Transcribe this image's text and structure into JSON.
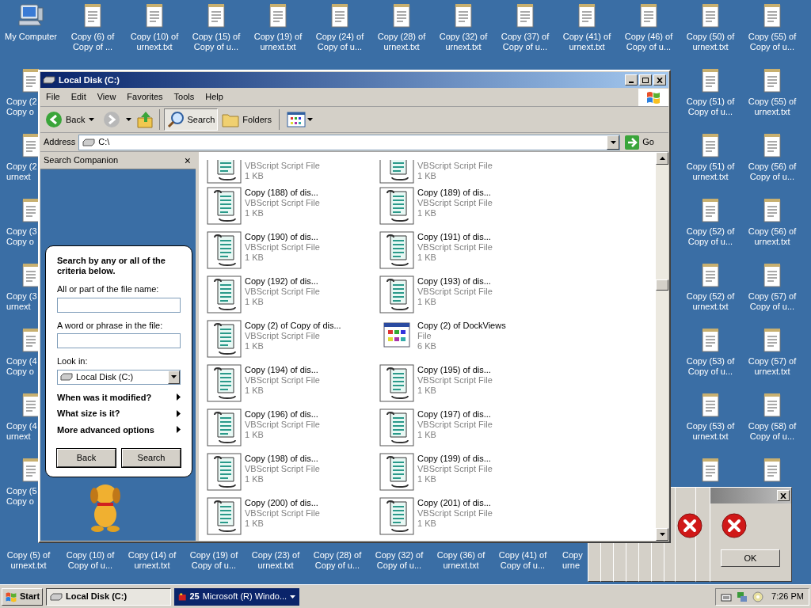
{
  "desktop": {
    "top_row": [
      {
        "kind": "computer",
        "lines": [
          "My Computer"
        ]
      },
      {
        "kind": "text",
        "lines": [
          "Copy (6) of",
          "Copy of ..."
        ]
      },
      {
        "kind": "text",
        "lines": [
          "Copy (10) of",
          "urnext.txt"
        ]
      },
      {
        "kind": "text",
        "lines": [
          "Copy (15) of",
          "Copy of u..."
        ]
      },
      {
        "kind": "text",
        "lines": [
          "Copy (19) of",
          "urnext.txt"
        ]
      },
      {
        "kind": "text",
        "lines": [
          "Copy (24) of",
          "Copy of u..."
        ]
      },
      {
        "kind": "text",
        "lines": [
          "Copy (28) of",
          "urnext.txt"
        ]
      },
      {
        "kind": "text",
        "lines": [
          "Copy (32) of",
          "urnext.txt"
        ]
      },
      {
        "kind": "text",
        "lines": [
          "Copy (37) of",
          "Copy of u..."
        ]
      },
      {
        "kind": "text",
        "lines": [
          "Copy (41) of",
          "urnext.txt"
        ]
      },
      {
        "kind": "text",
        "lines": [
          "Copy (46) of",
          "Copy of u..."
        ]
      },
      {
        "kind": "text",
        "lines": [
          "Copy (50) of",
          "urnext.txt"
        ]
      },
      {
        "kind": "text",
        "lines": [
          "Copy (55) of",
          "Copy of u..."
        ]
      }
    ],
    "left_column": [
      {
        "kind": "text",
        "lines": [
          "Copy (2",
          "Copy o"
        ]
      },
      {
        "kind": "text",
        "lines": [
          "Copy (2",
          "urnext"
        ]
      },
      {
        "kind": "text",
        "lines": [
          "Copy (3",
          "Copy o"
        ]
      },
      {
        "kind": "text",
        "lines": [
          "Copy (3",
          "urnext"
        ]
      },
      {
        "kind": "text",
        "lines": [
          "Copy (4",
          "Copy o"
        ]
      },
      {
        "kind": "text",
        "lines": [
          "Copy (4",
          "urnext"
        ]
      },
      {
        "kind": "text",
        "lines": [
          "Copy (5",
          "Copy o"
        ]
      }
    ],
    "right_column_1": [
      {
        "kind": "text",
        "lines": [
          "Copy (51) of",
          "Copy of u..."
        ]
      },
      {
        "kind": "text",
        "lines": [
          "Copy (51) of",
          "urnext.txt"
        ]
      },
      {
        "kind": "text",
        "lines": [
          "Copy (52) of",
          "Copy of u..."
        ]
      },
      {
        "kind": "text",
        "lines": [
          "Copy (52) of",
          "urnext.txt"
        ]
      },
      {
        "kind": "text",
        "lines": [
          "Copy (53) of",
          "Copy of u..."
        ]
      },
      {
        "kind": "text",
        "lines": [
          "Copy (53) of",
          "urnext.txt"
        ]
      },
      {
        "kind": "text"
      }
    ],
    "right_column_2": [
      {
        "kind": "text",
        "lines": [
          "Copy (55) of",
          "urnext.txt"
        ]
      },
      {
        "kind": "text",
        "lines": [
          "Copy (56) of",
          "Copy of u..."
        ]
      },
      {
        "kind": "text",
        "lines": [
          "Copy (56) of",
          "urnext.txt"
        ]
      },
      {
        "kind": "text",
        "lines": [
          "Copy (57) of",
          "Copy of u..."
        ]
      },
      {
        "kind": "text",
        "lines": [
          "Copy (57) of",
          "urnext.txt"
        ]
      },
      {
        "kind": "text",
        "lines": [
          "Copy (58) of",
          "Copy of u..."
        ]
      },
      {
        "kind": "text"
      }
    ],
    "bottom_row": [
      {
        "lines": [
          "Copy (5) of",
          "urnext.txt"
        ]
      },
      {
        "lines": [
          "Copy (10) of",
          "Copy of u..."
        ]
      },
      {
        "lines": [
          "Copy (14) of",
          "urnext.txt"
        ]
      },
      {
        "lines": [
          "Copy (19) of",
          "Copy of u..."
        ]
      },
      {
        "lines": [
          "Copy (23) of",
          "urnext.txt"
        ]
      },
      {
        "lines": [
          "Copy (28) of",
          "Copy of u..."
        ]
      },
      {
        "lines": [
          "Copy (32) of",
          "Copy of u..."
        ]
      },
      {
        "lines": [
          "Copy (36) of",
          "urnext.txt"
        ]
      },
      {
        "lines": [
          "Copy (41) of",
          "Copy of u..."
        ]
      },
      {
        "lines": [
          "Copy",
          "urne"
        ]
      }
    ]
  },
  "window": {
    "title": "Local Disk (C:)",
    "menu": [
      "File",
      "Edit",
      "View",
      "Favorites",
      "Tools",
      "Help"
    ],
    "toolbar": {
      "back": "Back",
      "search": "Search",
      "folders": "Folders",
      "search_selected": true
    },
    "address": {
      "label": "Address",
      "value": "C:\\",
      "go": "Go"
    },
    "search_companion": {
      "title": "Search Companion",
      "close": "×",
      "heading": "Search by any or all of the criteria below.",
      "name_label": "All or part of the file name:",
      "phrase_label": "A word or phrase in the file:",
      "look_in_label": "Look in:",
      "look_in_value": "Local Disk (C:)",
      "options": [
        "When was it modified?",
        "What size is it?",
        "More advanced options"
      ],
      "buttons": [
        "Back",
        "Search"
      ]
    },
    "files": [
      [
        {
          "kind": "script",
          "type": "VBScript Script File",
          "size": "1 KB"
        },
        {
          "kind": "script",
          "type": "VBScript Script File",
          "size": "1 KB"
        }
      ],
      [
        {
          "kind": "script",
          "name": "Copy (188) of dis...",
          "type": "VBScript Script File",
          "size": "1 KB"
        },
        {
          "kind": "script",
          "name": "Copy (189) of dis...",
          "type": "VBScript Script File",
          "size": "1 KB"
        }
      ],
      [
        {
          "kind": "script",
          "name": "Copy (190) of dis...",
          "type": "VBScript Script File",
          "size": "1 KB"
        },
        {
          "kind": "script",
          "name": "Copy (191) of dis...",
          "type": "VBScript Script File",
          "size": "1 KB"
        }
      ],
      [
        {
          "kind": "script",
          "name": "Copy (192) of dis...",
          "type": "VBScript Script File",
          "size": "1 KB"
        },
        {
          "kind": "script",
          "name": "Copy (193) of dis...",
          "type": "VBScript Script File",
          "size": "1 KB"
        }
      ],
      [
        {
          "kind": "script",
          "name": "Copy (2) of Copy of dis...",
          "type": "VBScript Script File",
          "size": "1 KB"
        },
        {
          "kind": "app",
          "name": "Copy (2) of DockViews",
          "type": "File",
          "size": "6 KB"
        }
      ],
      [
        {
          "kind": "script",
          "name": "Copy (194) of dis...",
          "type": "VBScript Script File",
          "size": "1 KB"
        },
        {
          "kind": "script",
          "name": "Copy (195) of dis...",
          "type": "VBScript Script File",
          "size": "1 KB"
        }
      ],
      [
        {
          "kind": "script",
          "name": "Copy (196) of dis...",
          "type": "VBScript Script File",
          "size": "1 KB"
        },
        {
          "kind": "script",
          "name": "Copy (197) of dis...",
          "type": "VBScript Script File",
          "size": "1 KB"
        }
      ],
      [
        {
          "kind": "script",
          "name": "Copy (198) of dis...",
          "type": "VBScript Script File",
          "size": "1 KB"
        },
        {
          "kind": "script",
          "name": "Copy (199) of dis...",
          "type": "VBScript Script File",
          "size": "1 KB"
        }
      ],
      [
        {
          "kind": "script",
          "name": "Copy (200) of dis...",
          "type": "VBScript Script File",
          "size": "1 KB"
        },
        {
          "kind": "script",
          "name": "Copy (201) of dis...",
          "type": "VBScript Script File",
          "size": "1 KB"
        }
      ]
    ]
  },
  "error_dialog": {
    "button": "OK"
  },
  "taskbar": {
    "start": "Start",
    "tasks": [
      {
        "label": "Local Disk (C:)",
        "kind": "drive",
        "selected": true
      },
      {
        "label": "Microsoft (R) Windo...",
        "kind": "group",
        "count": "25",
        "selected": false
      }
    ],
    "clock": "7:26 PM"
  }
}
